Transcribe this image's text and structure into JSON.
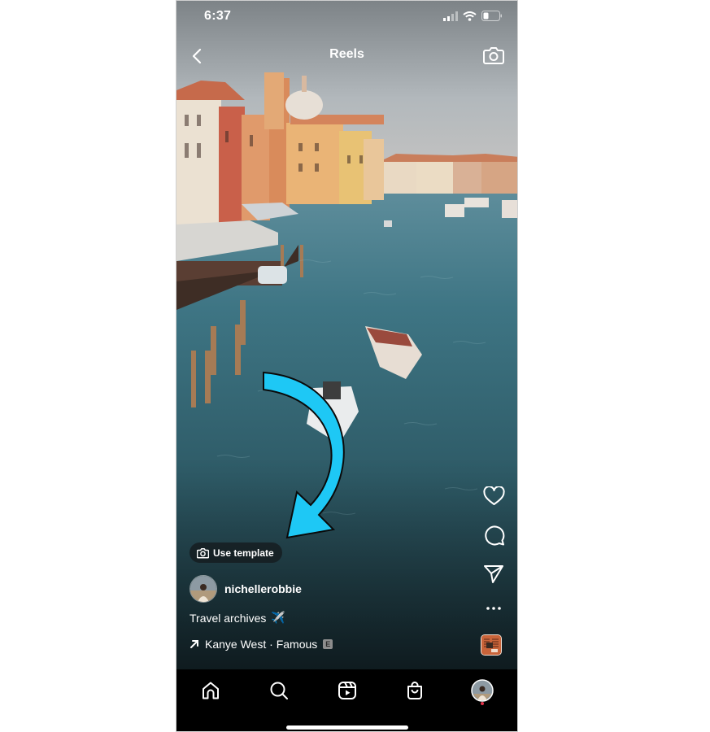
{
  "status_bar": {
    "time": "6:37",
    "signal_icon": "cellular-signal-icon",
    "wifi_icon": "wifi-icon",
    "battery_icon": "battery-low-icon"
  },
  "header": {
    "back_icon": "chevron-left-icon",
    "title": "Reels",
    "camera_icon": "camera-icon"
  },
  "reel": {
    "use_template": {
      "icon": "camera-icon",
      "label": "Use template"
    },
    "username": "nichellerobbie",
    "caption": "Travel archives",
    "caption_emoji": "✈️",
    "audio": {
      "icon": "arrow-up-right-icon",
      "artist": "Kanye West",
      "separator": "·",
      "track": "Famous",
      "explicit_badge": "E"
    },
    "annotation": {
      "type": "curved-arrow",
      "color": "#1ec8f5",
      "points_to": "use-template-button"
    }
  },
  "actions": [
    {
      "name": "like",
      "icon": "heart-icon"
    },
    {
      "name": "comment",
      "icon": "comment-icon"
    },
    {
      "name": "share",
      "icon": "send-icon"
    },
    {
      "name": "more",
      "icon": "more-horizontal-icon"
    },
    {
      "name": "audio-page",
      "icon": "audio-thumbnail"
    }
  ],
  "tab_bar": {
    "items": [
      {
        "name": "home",
        "icon": "home-icon"
      },
      {
        "name": "search",
        "icon": "search-icon"
      },
      {
        "name": "reels",
        "icon": "reels-icon"
      },
      {
        "name": "shop",
        "icon": "shopping-bag-icon"
      },
      {
        "name": "profile",
        "icon": "profile-avatar",
        "notification_dot": true
      }
    ],
    "notification_color": "#e0334a"
  },
  "colors": {
    "accent_arrow": "#1ec8f5",
    "tab_bar_bg": "#000000",
    "text": "#ffffff"
  }
}
